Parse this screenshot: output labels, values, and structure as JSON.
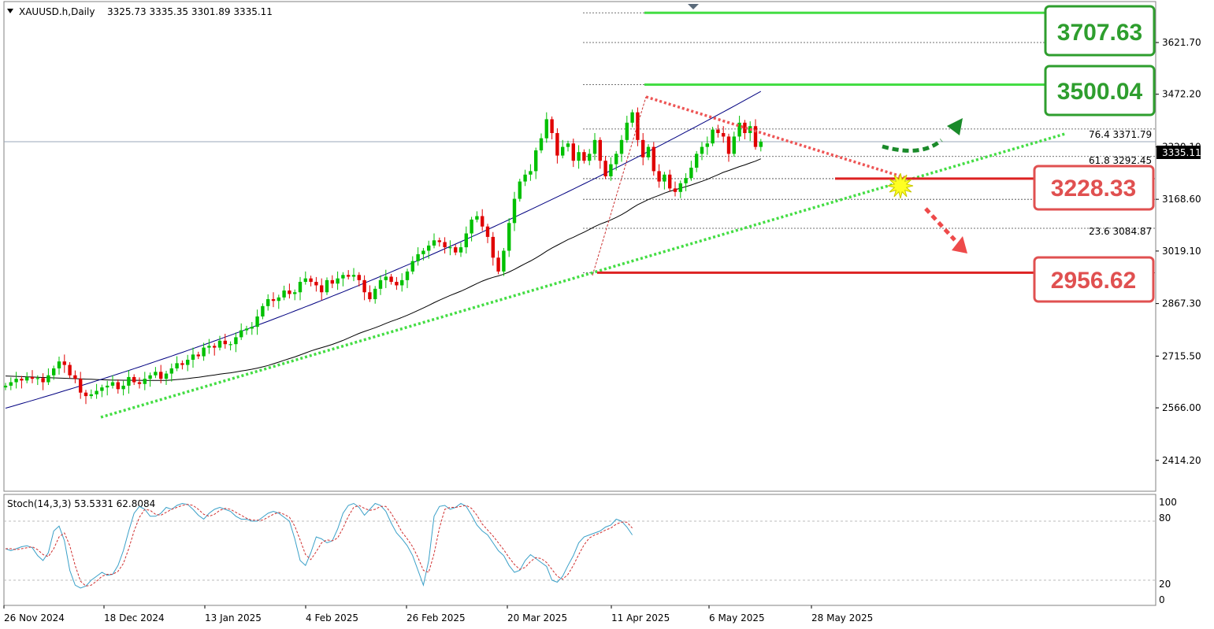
{
  "header": {
    "symbol": "XAUUSD.h,Daily",
    "ohlc": "3325.73 3335.35 3301.89 3335.11"
  },
  "stoch": {
    "label": "Stoch(14,3,3) 53.5331 62.8084",
    "levels": [
      80,
      20
    ],
    "axis_labels": [
      "100",
      "80",
      "20",
      "0"
    ],
    "k": [
      52,
      50,
      52,
      54,
      55,
      53,
      45,
      40,
      48,
      70,
      75,
      60,
      30,
      15,
      12,
      14,
      20,
      24,
      28,
      25,
      26,
      35,
      50,
      70,
      88,
      95,
      92,
      85,
      85,
      88,
      94,
      92,
      96,
      98,
      97,
      92,
      86,
      82,
      88,
      92,
      94,
      92,
      90,
      85,
      82,
      82,
      80,
      80,
      84,
      88,
      90,
      88,
      84,
      80,
      62,
      40,
      35,
      48,
      64,
      62,
      58,
      60,
      72,
      88,
      96,
      98,
      94,
      86,
      92,
      98,
      96,
      90,
      78,
      68,
      62,
      55,
      45,
      30,
      15,
      40,
      85,
      95,
      96,
      92,
      94,
      98,
      95,
      86,
      76,
      70,
      66,
      58,
      50,
      45,
      35,
      28,
      30,
      40,
      46,
      42,
      38,
      34,
      20,
      18,
      24,
      35,
      45,
      58,
      64,
      66,
      68,
      70,
      74,
      76,
      82,
      80,
      74,
      66
    ],
    "d": [
      52,
      52,
      51,
      52,
      53,
      54,
      51,
      46,
      44,
      52,
      64,
      68,
      55,
      35,
      19,
      14,
      15,
      19,
      24,
      26,
      26,
      29,
      37,
      52,
      70,
      84,
      92,
      91,
      87,
      86,
      89,
      92,
      94,
      96,
      97,
      96,
      92,
      87,
      85,
      87,
      91,
      93,
      92,
      89,
      86,
      83,
      81,
      81,
      81,
      84,
      87,
      89,
      87,
      84,
      75,
      61,
      46,
      41,
      49,
      58,
      61,
      60,
      63,
      73,
      85,
      94,
      96,
      93,
      91,
      92,
      95,
      95,
      88,
      79,
      69,
      62,
      54,
      43,
      30,
      28,
      47,
      73,
      92,
      94,
      94,
      95,
      96,
      93,
      86,
      77,
      71,
      65,
      58,
      51,
      43,
      36,
      31,
      33,
      39,
      43,
      42,
      38,
      31,
      24,
      21,
      26,
      35,
      46,
      56,
      63,
      66,
      68,
      71,
      73,
      77,
      79,
      79,
      73
    ]
  },
  "chart_data": {
    "type": "candlestick",
    "price_axis": [
      "3621.70",
      "3472.20",
      "3320.10",
      "3168.60",
      "3019.10",
      "2867.30",
      "2715.50",
      "2566.00",
      "2414.20"
    ],
    "ylim": [
      2325,
      3740
    ],
    "date_axis": [
      "26 Nov 2024",
      "18 Dec 2024",
      "13 Jan 2025",
      "4 Feb 2025",
      "26 Feb 2025",
      "20 Mar 2025",
      "11 Apr 2025",
      "6 May 2025",
      "28 May 2025"
    ],
    "current_price": "3335.11",
    "close": [
      2630,
      2640,
      2650,
      2645,
      2655,
      2650,
      2652,
      2640,
      2660,
      2680,
      2700,
      2690,
      2660,
      2650,
      2610,
      2600,
      2605,
      2615,
      2625,
      2630,
      2640,
      2620,
      2630,
      2655,
      2640,
      2635,
      2650,
      2660,
      2670,
      2650,
      2665,
      2680,
      2695,
      2690,
      2705,
      2720,
      2715,
      2740,
      2745,
      2740,
      2760,
      2750,
      2750,
      2770,
      2790,
      2795,
      2800,
      2830,
      2860,
      2880,
      2875,
      2885,
      2905,
      2895,
      2900,
      2930,
      2940,
      2930,
      2920,
      2900,
      2935,
      2925,
      2940,
      2950,
      2945,
      2950,
      2935,
      2900,
      2880,
      2910,
      2935,
      2945,
      2930,
      2920,
      2935,
      2960,
      2990,
      3010,
      3020,
      3035,
      3050,
      3045,
      3030,
      3030,
      3015,
      3030,
      3070,
      3110,
      3120,
      3090,
      3060,
      3000,
      2960,
      3020,
      3100,
      3170,
      3220,
      3240,
      3250,
      3310,
      3345,
      3400,
      3360,
      3295,
      3320,
      3330,
      3280,
      3305,
      3280,
      3300,
      3340,
      3280,
      3235,
      3270,
      3300,
      3340,
      3390,
      3420,
      3340,
      3290,
      3320,
      3250,
      3220,
      3240,
      3200,
      3190,
      3215,
      3230,
      3260,
      3300,
      3320,
      3330,
      3370,
      3360,
      3350,
      3300,
      3350,
      3390,
      3360,
      3380,
      3320,
      3335
    ],
    "fib_levels": [
      {
        "label": "76.4 3371.79",
        "value": 3371.79
      },
      {
        "label": "61.8 3292.45",
        "value": 3292.45
      },
      {
        "label": "23.6 3084.87",
        "value": 3084.87
      }
    ],
    "key_levels": [
      {
        "label": "3707.63",
        "value": 3707.63,
        "color": "#2e9e2e"
      },
      {
        "label": "3500.04",
        "value": 3500.04,
        "color": "#2e9e2e"
      },
      {
        "label": "3228.33",
        "value": 3228.33,
        "color": "#e05050"
      },
      {
        "label": "2956.62",
        "value": 2956.62,
        "color": "#e05050"
      }
    ]
  },
  "colors": {
    "bull": "#00c000",
    "bear": "#e00000",
    "green_box": "#2e9e2e",
    "red_box": "#e05050",
    "ma_fast": "#000000",
    "ma_slow": "#000080"
  }
}
